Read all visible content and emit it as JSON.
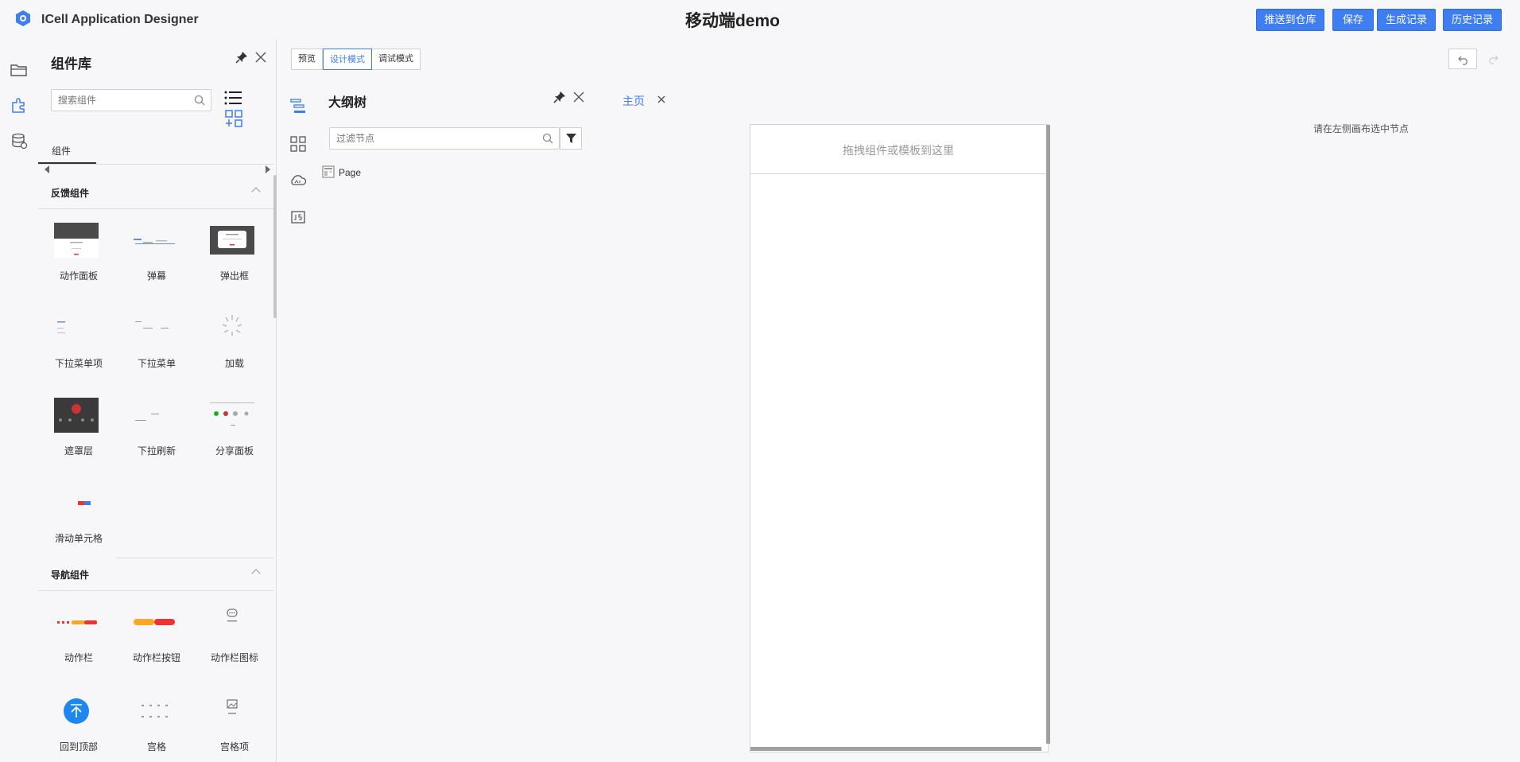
{
  "header": {
    "app_title": "ICell Application Designer",
    "page_title": "移动端demo",
    "buttons": {
      "push": "推送到仓库",
      "save": "保存",
      "generate": "生成记录",
      "history": "历史记录"
    },
    "accent_color": "#3f7ef0"
  },
  "library": {
    "title": "组件库",
    "search_placeholder": "搜索组件",
    "tab": "组件",
    "sections": [
      {
        "title": "反馈组件",
        "items": [
          "动作面板",
          "弹幕",
          "弹出框",
          "下拉菜单项",
          "下拉菜单",
          "加载",
          "遮罩层",
          "下拉刷新",
          "分享面板",
          "滑动单元格"
        ]
      },
      {
        "title": "导航组件",
        "items": [
          "动作栏",
          "动作栏按钮",
          "动作栏图标",
          "回到顶部",
          "宫格",
          "宫格项"
        ]
      }
    ]
  },
  "modes": {
    "preview": "预览",
    "design": "设计模式",
    "debug": "调试模式"
  },
  "outline": {
    "title": "大纲树",
    "filter_placeholder": "过滤节点",
    "nodes": [
      "Page"
    ]
  },
  "editor": {
    "tab_main": "主页",
    "drop_hint": "拖拽组件或模板到这里",
    "props_hint": "请在左侧画布选中节点"
  }
}
